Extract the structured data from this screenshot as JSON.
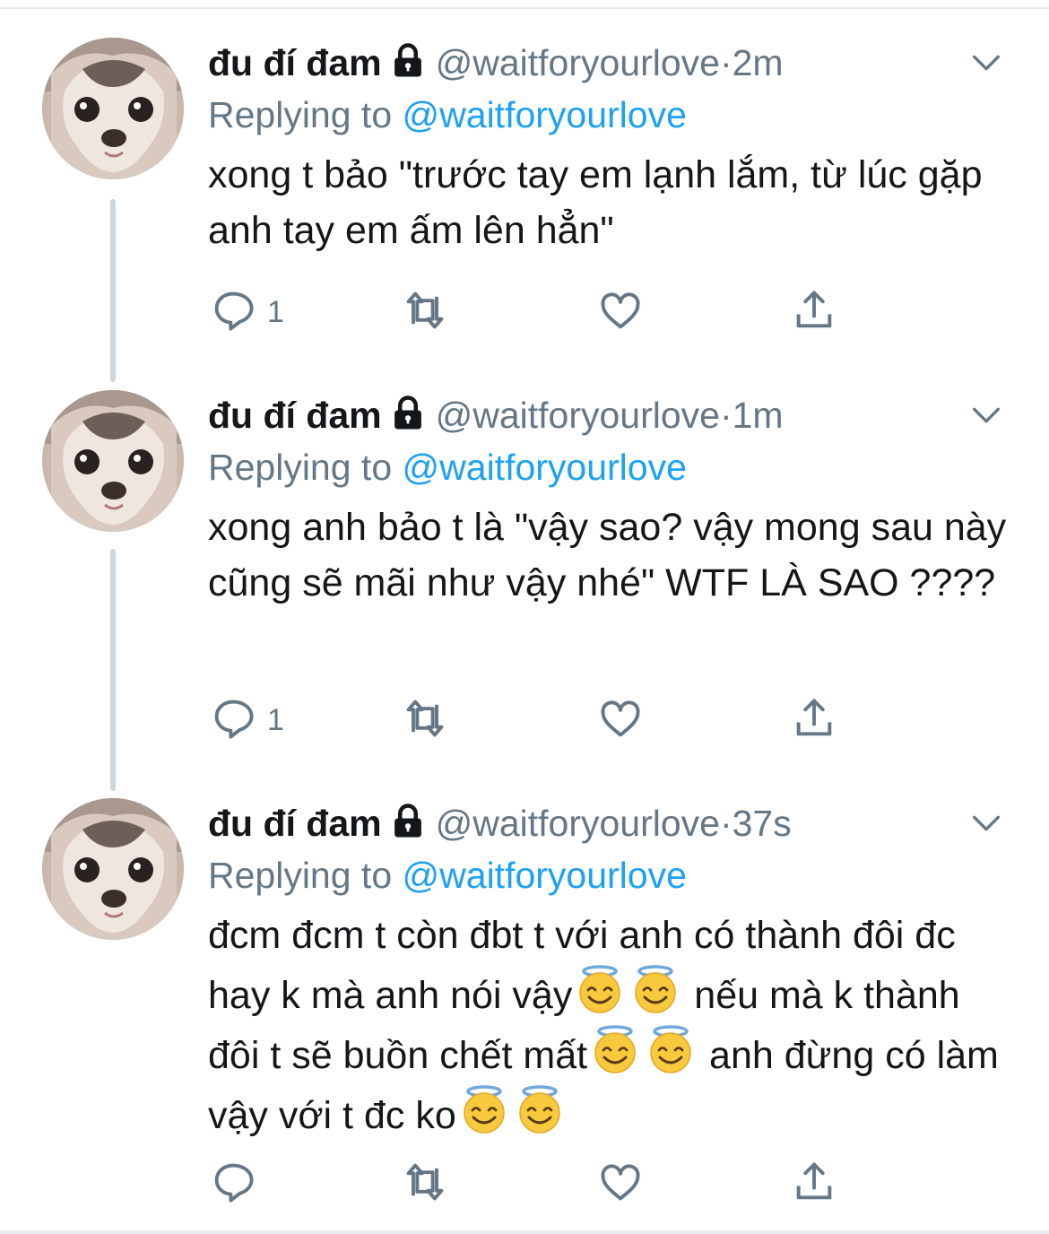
{
  "tweets": [
    {
      "name": "đu đí đam",
      "handle": "@waitforyourlove",
      "dot": "·",
      "time": "2m",
      "replying_prefix": "Replying to",
      "replying_to": "@waitforyourlove",
      "text_parts": [
        "xong t bảo \"trước tay em lạnh lắm, từ lúc gặp anh tay em ấm lên hẳn\""
      ],
      "reply_count": "1"
    },
    {
      "name": "đu đí đam",
      "handle": "@waitforyourlove",
      "dot": "·",
      "time": "1m",
      "replying_prefix": "Replying to",
      "replying_to": "@waitforyourlove",
      "text_parts": [
        "xong anh bảo t là \"vậy sao? vậy mong sau này cũng sẽ mãi như vậy nhé\" WTF LÀ SAO ????"
      ],
      "reply_count": "1"
    },
    {
      "name": "đu đí đam",
      "handle": "@waitforyourlove",
      "dot": "·",
      "time": "37s",
      "replying_prefix": "Replying to",
      "replying_to": "@waitforyourlove",
      "text_parts": [
        "đcm đcm t còn đbt t với anh có thành đôi đc hay k mà anh nói vậy",
        " nếu mà k thành đôi t sẽ buồn chết mất",
        " anh đừng có làm vậy với t đc ko"
      ],
      "emoji": "smiling-face-with-halo",
      "reply_count": ""
    }
  ],
  "icons": [
    "lock-icon",
    "chevron-down-icon",
    "reply-icon",
    "retweet-icon",
    "like-icon",
    "share-icon",
    "smiling-face-with-halo-emoji"
  ],
  "colors": {
    "link": "#1da1f2",
    "secondary": "#657786",
    "text": "#14171a",
    "thread_line": "#ccd6dd"
  }
}
